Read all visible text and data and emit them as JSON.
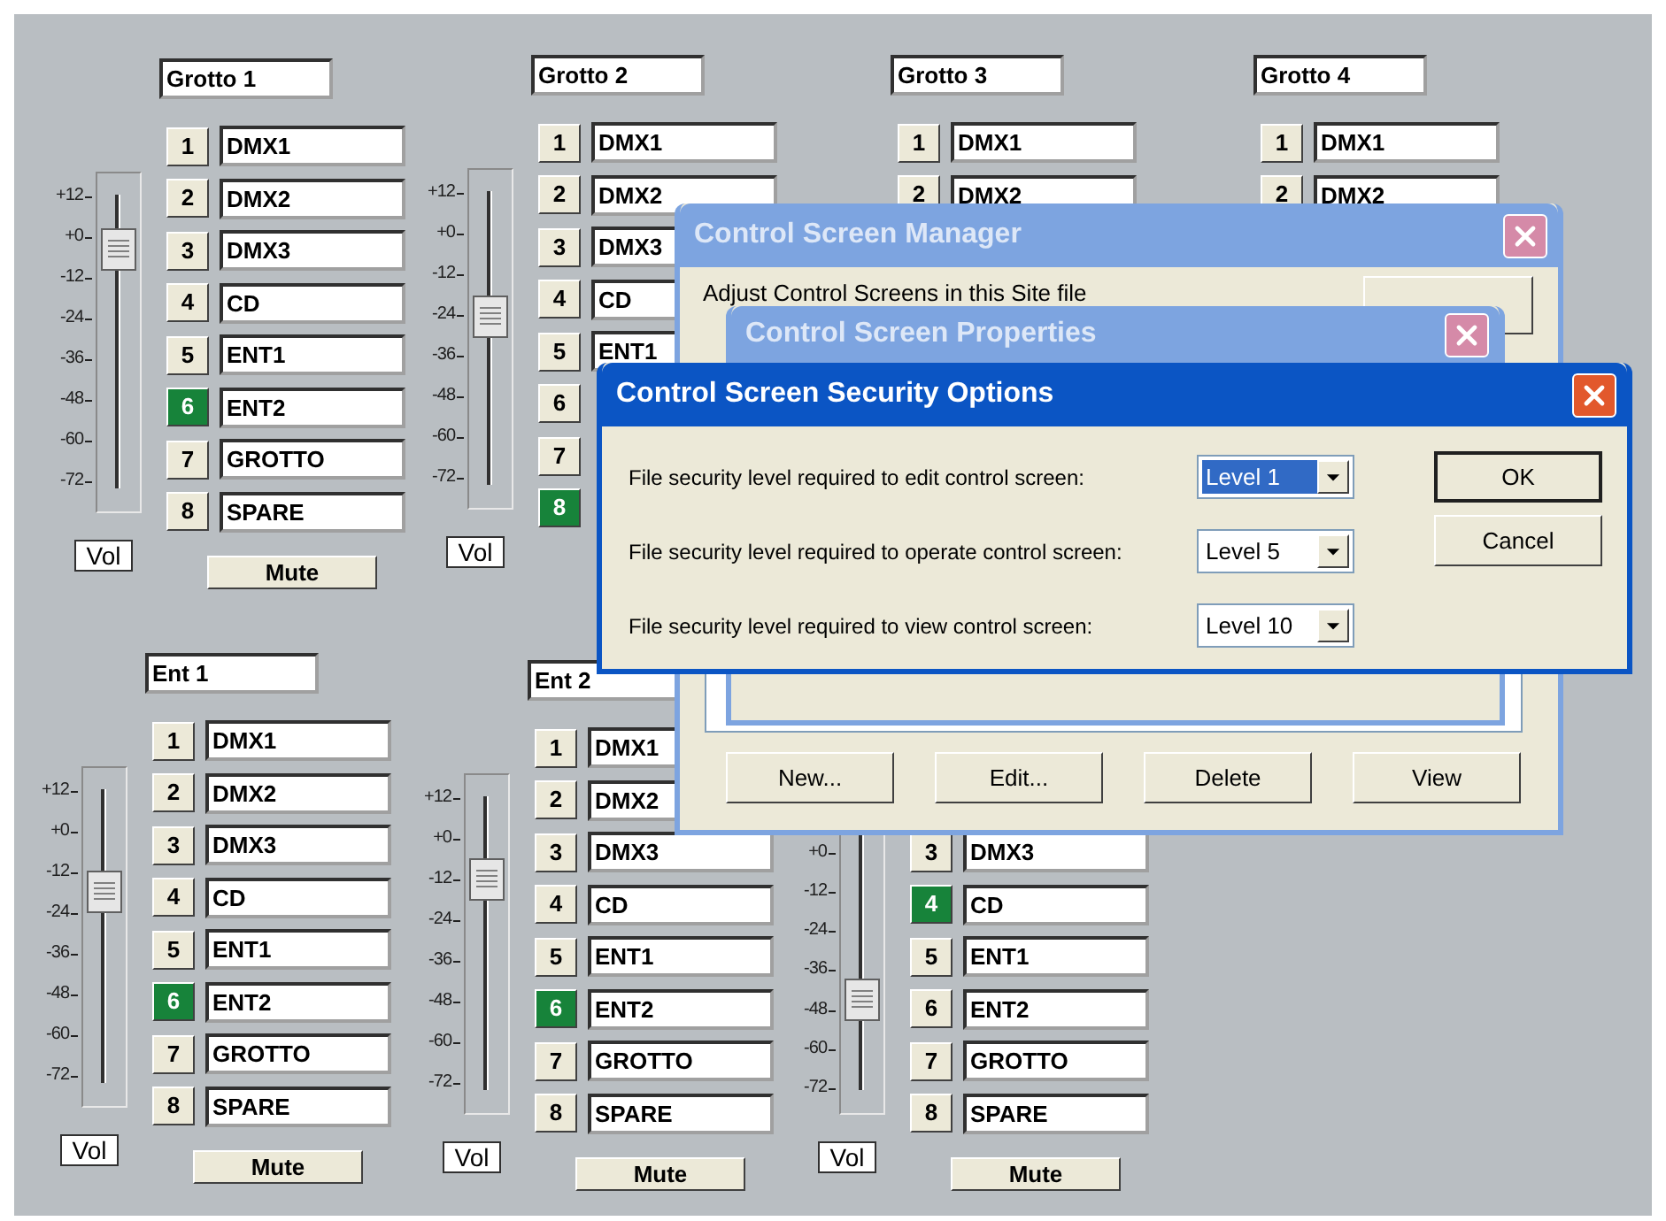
{
  "panels": [
    {
      "title": "Grotto 1",
      "scale": [
        "+12",
        "+0",
        "-12",
        "-24",
        "-36",
        "-48",
        "-60",
        "-72"
      ],
      "level": 0.82,
      "vol": "Vol",
      "mute": "Mute",
      "channels": [
        {
          "number": "1",
          "name": "DMX1",
          "selected": false
        },
        {
          "number": "2",
          "name": "DMX2",
          "selected": false
        },
        {
          "number": "3",
          "name": "DMX3",
          "selected": false
        },
        {
          "number": "4",
          "name": "CD",
          "selected": false
        },
        {
          "number": "5",
          "name": "ENT1",
          "selected": false
        },
        {
          "number": "6",
          "name": "ENT2",
          "selected": true
        },
        {
          "number": "7",
          "name": "GROTTO",
          "selected": false
        },
        {
          "number": "8",
          "name": "SPARE",
          "selected": false
        }
      ]
    },
    {
      "title": "Grotto 2",
      "scale": [
        "+12",
        "+0",
        "-12",
        "-24",
        "-36",
        "-48",
        "-60",
        "-72"
      ],
      "level": 0.57,
      "vol": "Vol",
      "channels": [
        {
          "number": "1",
          "name": "DMX1",
          "selected": false
        },
        {
          "number": "2",
          "name": "DMX2",
          "selected": false
        },
        {
          "number": "3",
          "name": "DMX3",
          "selected": false
        },
        {
          "number": "4",
          "name": "CD",
          "selected": false
        },
        {
          "number": "5",
          "name": "ENT1",
          "selected": false
        },
        {
          "number": "6",
          "selected": false
        },
        {
          "number": "7",
          "selected": false
        },
        {
          "number": "8",
          "selected": true
        }
      ]
    },
    {
      "title": "Grotto 3",
      "channels": [
        {
          "number": "1",
          "name": "DMX1",
          "selected": false
        },
        {
          "number": "2",
          "name": "DMX2",
          "selected": false
        }
      ]
    },
    {
      "title": "Grotto 4",
      "channels": [
        {
          "number": "1",
          "name": "DMX1",
          "selected": false
        },
        {
          "number": "2",
          "name": "DMX2",
          "selected": false
        }
      ]
    },
    {
      "title": "Ent 1",
      "scale": [
        "+12",
        "+0",
        "-12",
        "-24",
        "-36",
        "-48",
        "-60",
        "-72"
      ],
      "level": 0.65,
      "vol": "Vol",
      "mute": "Mute",
      "channels": [
        {
          "number": "1",
          "name": "DMX1",
          "selected": false
        },
        {
          "number": "2",
          "name": "DMX2",
          "selected": false
        },
        {
          "number": "3",
          "name": "DMX3",
          "selected": false
        },
        {
          "number": "4",
          "name": "CD",
          "selected": false
        },
        {
          "number": "5",
          "name": "ENT1",
          "selected": false
        },
        {
          "number": "6",
          "name": "ENT2",
          "selected": true
        },
        {
          "number": "7",
          "name": "GROTTO",
          "selected": false
        },
        {
          "number": "8",
          "name": "SPARE",
          "selected": false
        }
      ]
    },
    {
      "title": "Ent 2",
      "scale": [
        "+12",
        "+0",
        "-12",
        "-24",
        "-36",
        "-48",
        "-60",
        "-72"
      ],
      "level": 0.72,
      "vol": "Vol",
      "mute": "Mute",
      "channels": [
        {
          "number": "1",
          "name": "DMX1",
          "selected": false
        },
        {
          "number": "2",
          "name": "DMX2",
          "selected": false
        },
        {
          "number": "3",
          "name": "DMX3",
          "selected": false
        },
        {
          "number": "4",
          "name": "CD",
          "selected": false
        },
        {
          "number": "5",
          "name": "ENT1",
          "selected": false
        },
        {
          "number": "6",
          "name": "ENT2",
          "selected": true
        },
        {
          "number": "7",
          "name": "GROTTO",
          "selected": false
        },
        {
          "number": "8",
          "name": "SPARE",
          "selected": false
        }
      ]
    },
    {
      "scale": [
        "+0",
        "-12",
        "-24",
        "-36",
        "-48",
        "-60",
        "-72"
      ],
      "level": 0.3,
      "vol": "Vol",
      "mute": "Mute",
      "channels": [
        {
          "number": "3",
          "name": "DMX3",
          "selected": false
        },
        {
          "number": "4",
          "name": "CD",
          "selected": true
        },
        {
          "number": "5",
          "name": "ENT1",
          "selected": false
        },
        {
          "number": "6",
          "name": "ENT2",
          "selected": false
        },
        {
          "number": "7",
          "name": "GROTTO",
          "selected": false
        },
        {
          "number": "8",
          "name": "SPARE",
          "selected": false
        }
      ]
    }
  ],
  "windows": [
    {
      "kind": "manager",
      "title": "Control Screen Manager",
      "active": false,
      "description": "Adjust Control Screens in this Site file",
      "buttons": [
        "New...",
        "Edit...",
        "Delete",
        "View"
      ]
    },
    {
      "kind": "properties",
      "title": "Control Screen Properties",
      "active": false
    },
    {
      "kind": "security",
      "title": "Control Screen Security Options",
      "active": true,
      "settings": [
        {
          "label": "File security level required to edit control screen:",
          "value": "Level 1",
          "focused": true
        },
        {
          "label": "File security level required to operate control screen:",
          "value": "Level 5",
          "focused": false
        },
        {
          "label": "File security level required to view control screen:",
          "value": "Level 10",
          "focused": false
        }
      ],
      "buttons": [
        "OK",
        "Cancel"
      ]
    }
  ]
}
